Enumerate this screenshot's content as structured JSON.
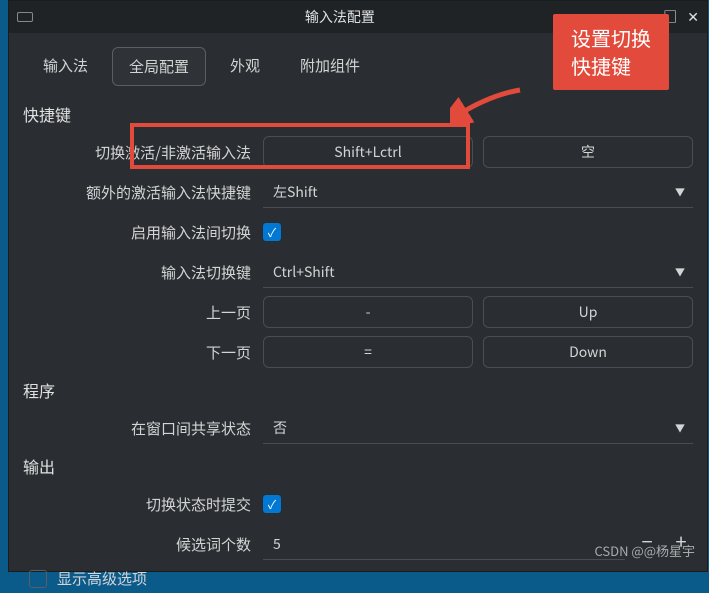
{
  "window": {
    "title": "输入法配置",
    "controls": {
      "min": "—",
      "max": "□",
      "close": "✕"
    }
  },
  "tabs": {
    "items": [
      "输入法",
      "全局配置",
      "外观",
      "附加组件"
    ],
    "active": 1
  },
  "sections": {
    "shortcut": "快捷键",
    "program": "程序",
    "output": "输出"
  },
  "fields": {
    "toggle_activate": {
      "label": "切换激活/非激活输入法",
      "key": "Shift+Lctrl",
      "empty": "空"
    },
    "extra_activate": {
      "label": "额外的激活输入法快捷键",
      "value": "左Shift"
    },
    "enable_switch": {
      "label": "启用输入法间切换",
      "checked": true
    },
    "im_switch_key": {
      "label": "输入法切换键",
      "value": "Ctrl+Shift"
    },
    "prev_page": {
      "label": "上一页",
      "key1": "-",
      "key2": "Up"
    },
    "next_page": {
      "label": "下一页",
      "key1": "=",
      "key2": "Down"
    },
    "share_state": {
      "label": "在窗口间共享状态",
      "value": "否"
    },
    "commit_on_switch": {
      "label": "切换状态时提交",
      "checked": true
    },
    "candidate_count": {
      "label": "候选词个数",
      "value": "5"
    },
    "show_advanced": {
      "label": "显示高级选项",
      "checked": false
    }
  },
  "callout": {
    "line1": "设置切换",
    "line2": "快捷键"
  },
  "watermark": "CSDN @@杨星宇"
}
